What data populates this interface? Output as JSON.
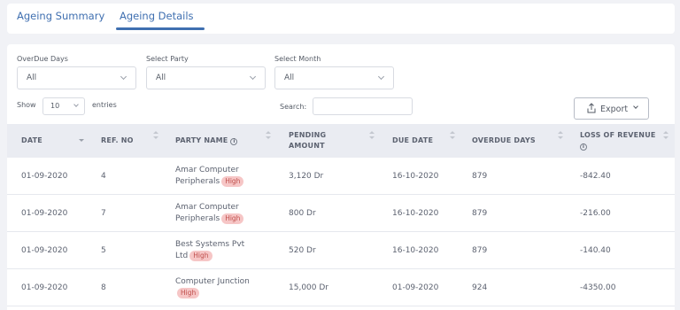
{
  "tabs": [
    {
      "label": "Ageing Summary",
      "active": false
    },
    {
      "label": "Ageing Details",
      "active": true
    }
  ],
  "filters": {
    "overdue": {
      "label": "OverDue Days",
      "value": "All"
    },
    "party": {
      "label": "Select Party",
      "value": "All"
    },
    "month": {
      "label": "Select Month",
      "value": "All"
    }
  },
  "entries": {
    "show_label": "Show",
    "value": "10",
    "suffix": "entries"
  },
  "search": {
    "label": "Search:",
    "value": ""
  },
  "export": {
    "label": "Export",
    "icon": "upload-icon"
  },
  "columns": [
    "DATE",
    "REF. NO",
    "PARTY NAME",
    "PENDING AMOUNT",
    "DUE DATE",
    "OVERDUE DAYS",
    "LOSS OF REVENUE"
  ],
  "rows": [
    {
      "date": "01-09-2020",
      "ref": "4",
      "party_line1": "Amar Computer",
      "party_line2": "Peripherals",
      "badge": "High",
      "amount": "3,120 Dr",
      "due": "16-10-2020",
      "overdue": "879",
      "loss": "-842.40"
    },
    {
      "date": "01-09-2020",
      "ref": "7",
      "party_line1": "Amar Computer",
      "party_line2": "Peripherals",
      "badge": "High",
      "amount": "800 Dr",
      "due": "16-10-2020",
      "overdue": "879",
      "loss": "-216.00"
    },
    {
      "date": "01-09-2020",
      "ref": "5",
      "party_line1": "Best Systems Pvt",
      "party_line2": "Ltd",
      "badge": "High",
      "amount": "520 Dr",
      "due": "16-10-2020",
      "overdue": "879",
      "loss": "-140.40"
    },
    {
      "date": "01-09-2020",
      "ref": "8",
      "party_line1": "Computer Junction",
      "party_line2": "",
      "badge": "High",
      "amount": "15,000 Dr",
      "due": "01-09-2020",
      "overdue": "924",
      "loss": "-4350.00"
    }
  ],
  "colors": {
    "accent": "#3f6fb0",
    "badge_bg": "#f6c6c6",
    "badge_text": "#c0504d",
    "header_bg": "#eaecf2"
  }
}
